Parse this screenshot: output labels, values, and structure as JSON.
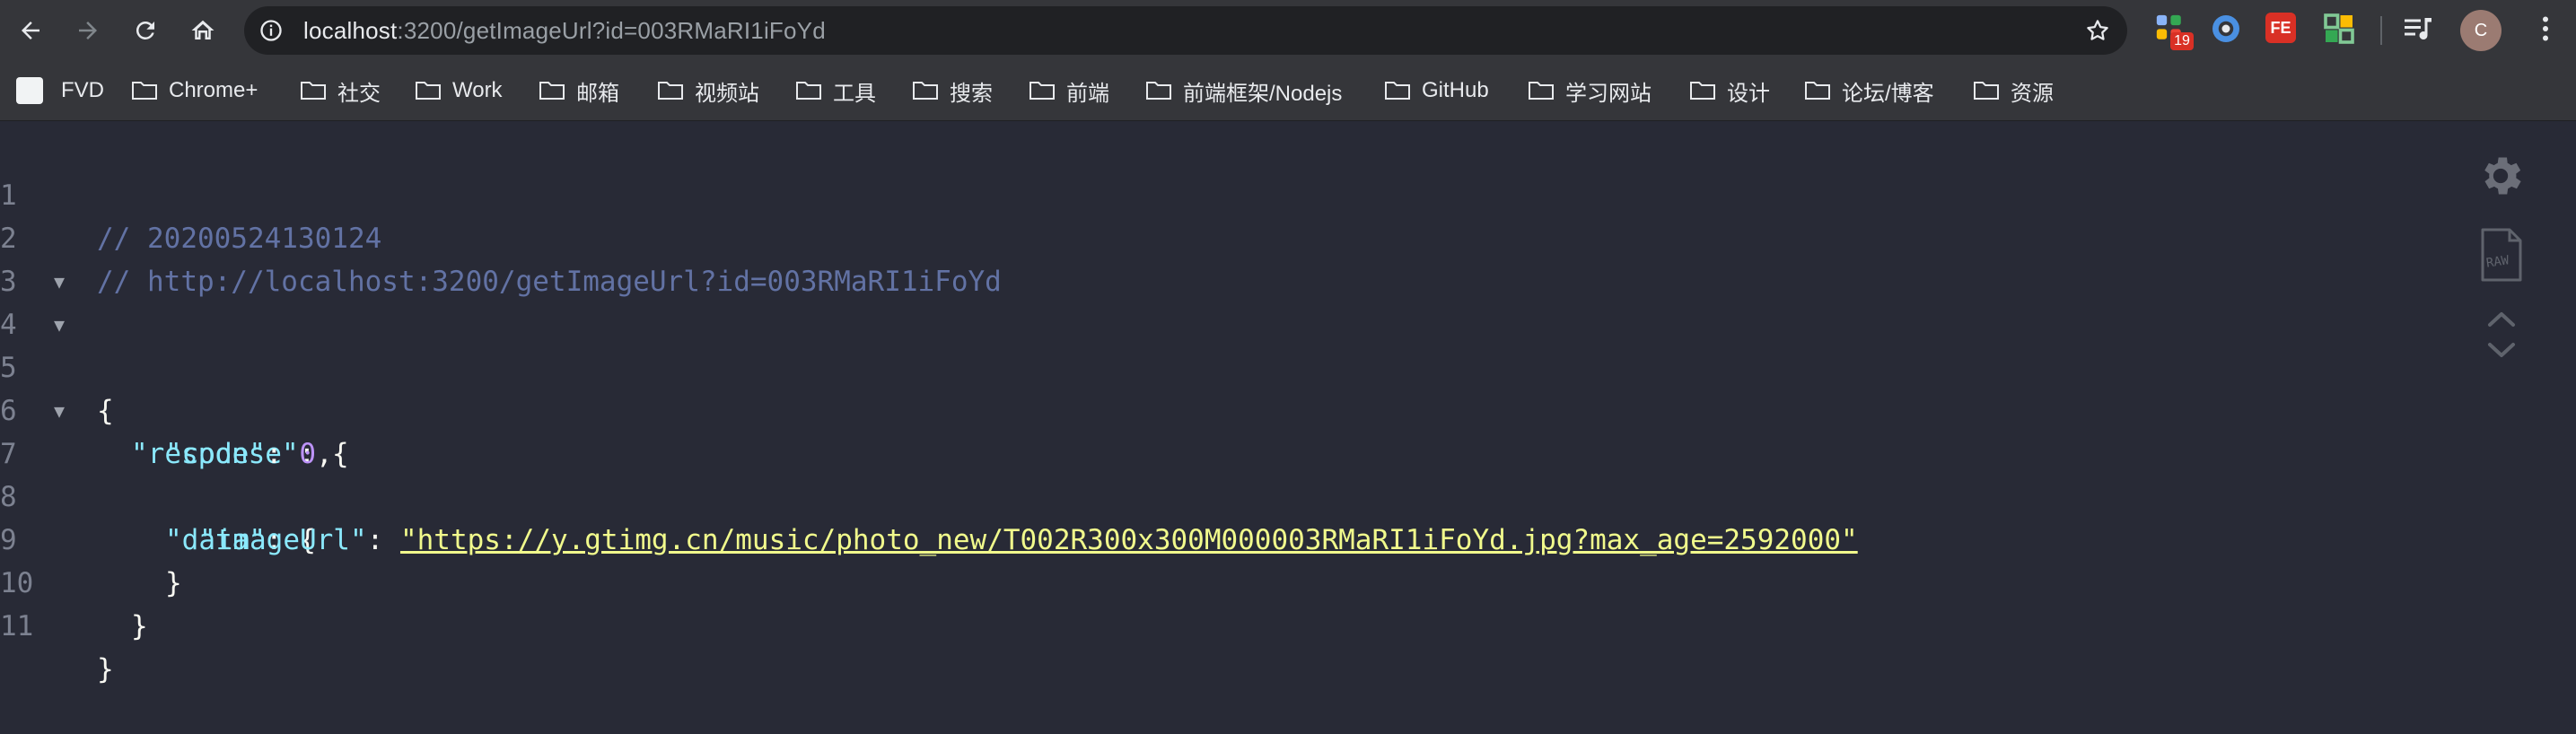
{
  "browser": {
    "url_host": "localhost",
    "url_rest": ":3200/getImageUrl?id=003RMaRI1iFoYd",
    "extensions": [
      {
        "name": "apps-extension-icon",
        "badge": "19"
      },
      {
        "name": "circle-extension-icon",
        "badge": ""
      },
      {
        "name": "fe-extension-icon",
        "label": "FE"
      },
      {
        "name": "grid-extension-icon",
        "badge": ""
      }
    ],
    "avatar_letter": "C"
  },
  "bookmarks": [
    {
      "label": "FVD",
      "type": "page"
    },
    {
      "label": "Chrome+",
      "type": "folder"
    },
    {
      "label": "社交",
      "type": "folder"
    },
    {
      "label": "Work",
      "type": "folder"
    },
    {
      "label": "邮箱",
      "type": "folder"
    },
    {
      "label": "视频站",
      "type": "folder"
    },
    {
      "label": "工具",
      "type": "folder"
    },
    {
      "label": "搜索",
      "type": "folder"
    },
    {
      "label": "前端",
      "type": "folder"
    },
    {
      "label": "前端框架/Nodejs",
      "type": "folder"
    },
    {
      "label": "GitHub",
      "type": "folder"
    },
    {
      "label": "学习网站",
      "type": "folder"
    },
    {
      "label": "设计",
      "type": "folder"
    },
    {
      "label": "论坛/博客",
      "type": "folder"
    },
    {
      "label": "资源",
      "type": "folder"
    }
  ],
  "code": {
    "line_numbers": [
      "1",
      "2",
      "3",
      "4",
      "5",
      "6",
      "7",
      "8",
      "9",
      "10",
      "11"
    ],
    "comment_timestamp": "// 20200524130124",
    "comment_url": "// http://localhost:3200/getImageUrl?id=003RMaRI1iFoYd",
    "brace_open": "{",
    "brace_close": "}",
    "key_response": "\"response\"",
    "key_code": "\"code\"",
    "value_code": "0",
    "key_data": "\"data\"",
    "key_imageUrl": "\"imageUrl\"",
    "value_imageUrl": "\"https://y.gtimg.cn/music/photo_new/T002R300x300M000003RMaRI1iFoYd.jpg?max_age=2592000\"",
    "colon_brace": ": {",
    "colon": ": ",
    "comma": ","
  },
  "tools": {
    "raw_label": "RAW"
  }
}
